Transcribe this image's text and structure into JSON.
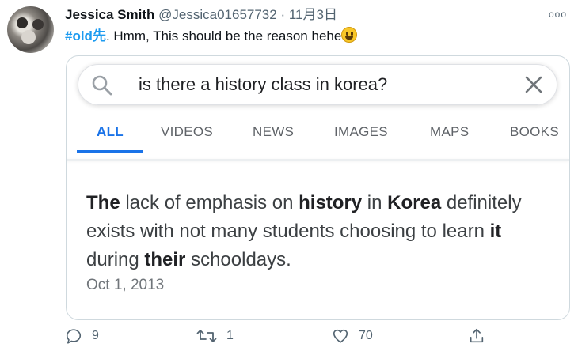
{
  "tweet": {
    "author_name": "Jessica Smith",
    "author_handle": "@Jessica01657732",
    "separator": " · ",
    "timestamp": "11月3日",
    "more_label": "ooo",
    "hashtag": "#old先",
    "text": ". Hmm, This should be the reason hehe",
    "emoji": "smiley-face-emoji"
  },
  "card": {
    "search": {
      "query": "is there a history class in korea?",
      "search_icon": "search-icon",
      "clear_icon": "close-icon"
    },
    "tabs": [
      {
        "label": "ALL",
        "active": true
      },
      {
        "label": "VIDEOS",
        "active": false
      },
      {
        "label": "NEWS",
        "active": false
      },
      {
        "label": "IMAGES",
        "active": false
      },
      {
        "label": "MAPS",
        "active": false
      },
      {
        "label": "BOOKS",
        "active": false
      }
    ],
    "snippet": {
      "p1_bold": "The",
      "p2": " lack of emphasis on ",
      "p3_bold": "history",
      "p4": " in ",
      "p5_bold": "Korea",
      "p6": " definitely exists with not many students choosing to learn ",
      "p7_bold": "it",
      "p8": " during ",
      "p9_bold": "their",
      "p10": " schooldays."
    },
    "date": "Oct 1, 2013"
  },
  "actions": {
    "reply_count": "9",
    "retweet_count": "1",
    "like_count": "70"
  },
  "colors": {
    "link": "#1d9bf0",
    "google_blue": "#1a73e8",
    "muted": "#536471"
  }
}
